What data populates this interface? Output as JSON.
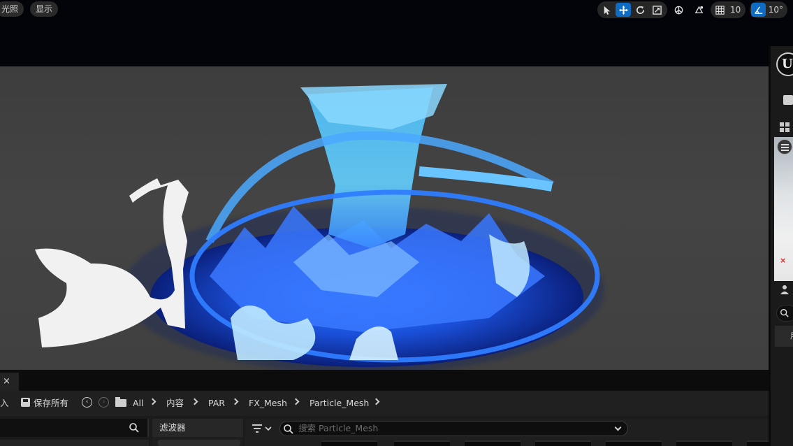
{
  "viewport": {
    "lighting_label": "光照",
    "show_label": "显示",
    "toolbar": {
      "tools": [
        "select-icon",
        "translate-icon",
        "rotate-icon",
        "scale-icon",
        "local-space-icon",
        "surface-snap-icon"
      ],
      "active_tool": "translate-icon",
      "grid_snap_value": "10",
      "rotation_snap_value": "10°",
      "accent_color": "#0e6cc4"
    }
  },
  "right_panel": {
    "logo_glyph": "U",
    "axis_marker": "×",
    "partial_label": "用"
  },
  "content_browser": {
    "close_glyph": "×",
    "import_partial": "入",
    "save_all_label": "保存所有",
    "breadcrumb": [
      "All",
      "内容",
      "PAR",
      "FX_Mesh",
      "Particle_Mesh"
    ],
    "filters_label": "滤波器",
    "search_placeholder": "搜索 Particle_Mesh"
  }
}
